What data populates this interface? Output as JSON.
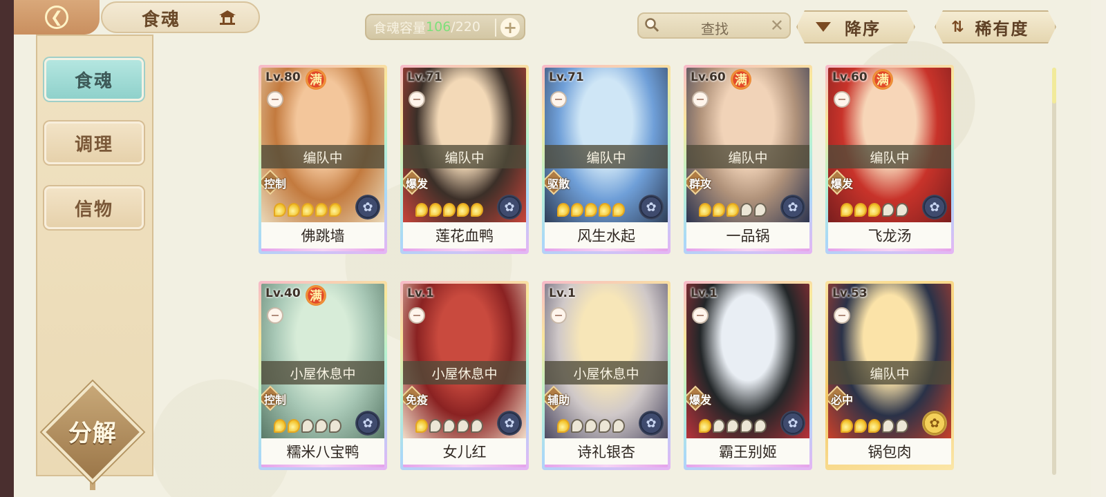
{
  "header": {
    "back_icon": "back-chevron-icon",
    "title": "食魂",
    "home_icon": "pavilion-home-icon",
    "capacity": {
      "label": "食魂容量",
      "current": "106",
      "separator": "/",
      "max": "220",
      "add_icon": "plus-icon"
    },
    "search": {
      "placeholder": "查找",
      "search_icon": "magnifier-icon",
      "clear_icon": "close-icon"
    },
    "sort_button": {
      "label": "降序",
      "icon": "triangle-down-icon"
    },
    "rarity_button": {
      "label": "稀有度",
      "icon": "swap-arrows-icon"
    }
  },
  "sidebar": {
    "items": [
      {
        "label": "食魂",
        "active": true
      },
      {
        "label": "调理",
        "active": false
      },
      {
        "label": "信物",
        "active": false
      }
    ],
    "decompose_label": "分解"
  },
  "cards": [
    {
      "level": "Lv.80",
      "full": "满",
      "status": "编队中",
      "role": "控制",
      "flames_on": 5,
      "name": "佛跳墙",
      "frame": "rainbow",
      "element": "dark",
      "art": [
        "#f3c69b",
        "#c37a3e",
        "#e9d8b8"
      ]
    },
    {
      "level": "Lv.71",
      "full": "",
      "status": "编队中",
      "role": "爆发",
      "flames_on": 5,
      "name": "莲花血鸭",
      "frame": "rainbow",
      "element": "dark",
      "art": [
        "#f3d9b7",
        "#3b2f28",
        "#c9443a"
      ]
    },
    {
      "level": "Lv.71",
      "full": "",
      "status": "编队中",
      "role": "驱散",
      "flames_on": 5,
      "name": "风生水起",
      "frame": "rainbow",
      "element": "dark",
      "art": [
        "#cfe6f6",
        "#6f9fd8",
        "#2f3e58"
      ]
    },
    {
      "level": "Lv.60",
      "full": "满",
      "status": "编队中",
      "role": "群攻",
      "flames_on": 3,
      "name": "一品锅",
      "frame": "rainbow",
      "element": "dark",
      "art": [
        "#f1d3b8",
        "#b0927a",
        "#2c3450"
      ]
    },
    {
      "level": "Lv.60",
      "full": "满",
      "status": "编队中",
      "role": "爆发",
      "flames_on": 3,
      "name": "飞龙汤",
      "frame": "rainbow",
      "element": "dark",
      "art": [
        "#f7d6b8",
        "#c8332a",
        "#7a1e1e"
      ]
    },
    {
      "level": "Lv.40",
      "full": "满",
      "status": "小屋休息中",
      "role": "控制",
      "flames_on": 2,
      "name": "糯米八宝鸭",
      "frame": "rainbow",
      "element": "dark",
      "art": [
        "#d7ecd8",
        "#a8c8b6",
        "#5a7a68"
      ]
    },
    {
      "level": "Lv.1",
      "full": "",
      "status": "小屋休息中",
      "role": "免疫",
      "flames_on": 1,
      "name": "女儿红",
      "frame": "rainbow",
      "element": "dark",
      "art": [
        "#c94a3e",
        "#8a2222",
        "#f1dcc8"
      ]
    },
    {
      "level": "Lv.1",
      "full": "",
      "status": "小屋休息中",
      "role": "辅助",
      "flames_on": 1,
      "name": "诗礼银杏",
      "frame": "rainbow",
      "element": "dark",
      "art": [
        "#f7e6b8",
        "#cfc8c8",
        "#4e4a62"
      ]
    },
    {
      "level": "Lv.1",
      "full": "",
      "status": "",
      "role": "爆发",
      "flames_on": 1,
      "name": "霸王别姬",
      "frame": "rainbow",
      "element": "dark",
      "art": [
        "#e9eef4",
        "#222628",
        "#b8323a"
      ]
    },
    {
      "level": "Lv.53",
      "full": "",
      "status": "编队中",
      "role": "必中",
      "flames_on": 3,
      "name": "锅包肉",
      "frame": "gold",
      "element": "gold",
      "art": [
        "#fbe3a8",
        "#2a3248",
        "#c8402a"
      ]
    }
  ],
  "colors": {
    "accent_teal": "#8fd1cb",
    "capacity_current": "#7de07a",
    "brown_text": "#6a4a2a"
  }
}
